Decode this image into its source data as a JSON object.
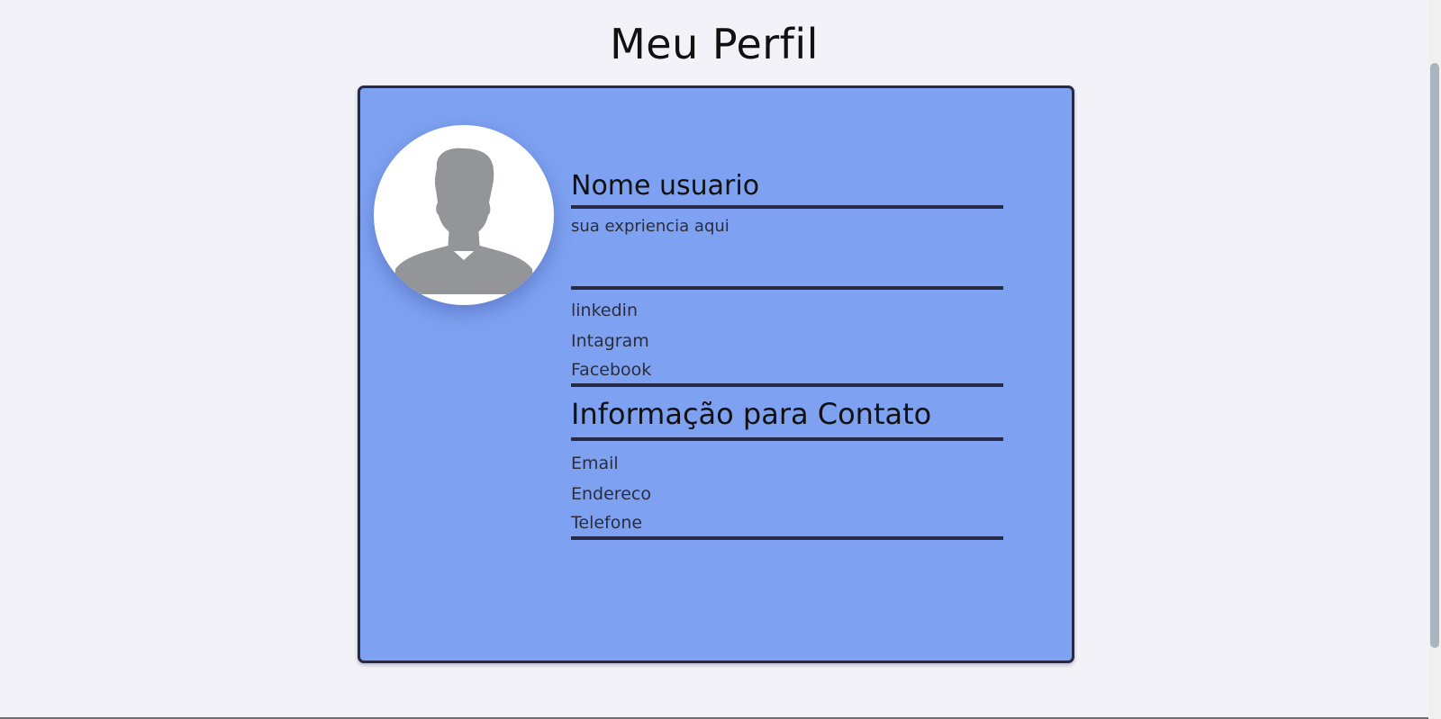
{
  "page": {
    "title": "Meu Perfil"
  },
  "profile": {
    "avatar_icon": "user-silhouette-icon",
    "name": "Nome usuario",
    "experience": "sua expriencia aqui",
    "social": [
      {
        "label": "linkedin"
      },
      {
        "label": "Intagram"
      },
      {
        "label": "Facebook"
      }
    ]
  },
  "contact": {
    "title": "Informação para Contato",
    "items": [
      {
        "label": "Email"
      },
      {
        "label": "Endereco"
      },
      {
        "label": "Telefone"
      }
    ]
  },
  "colors": {
    "background": "#f3f2f8",
    "card": "#7ea2f1",
    "border": "#262a44",
    "avatar_silhouette": "#939599"
  }
}
